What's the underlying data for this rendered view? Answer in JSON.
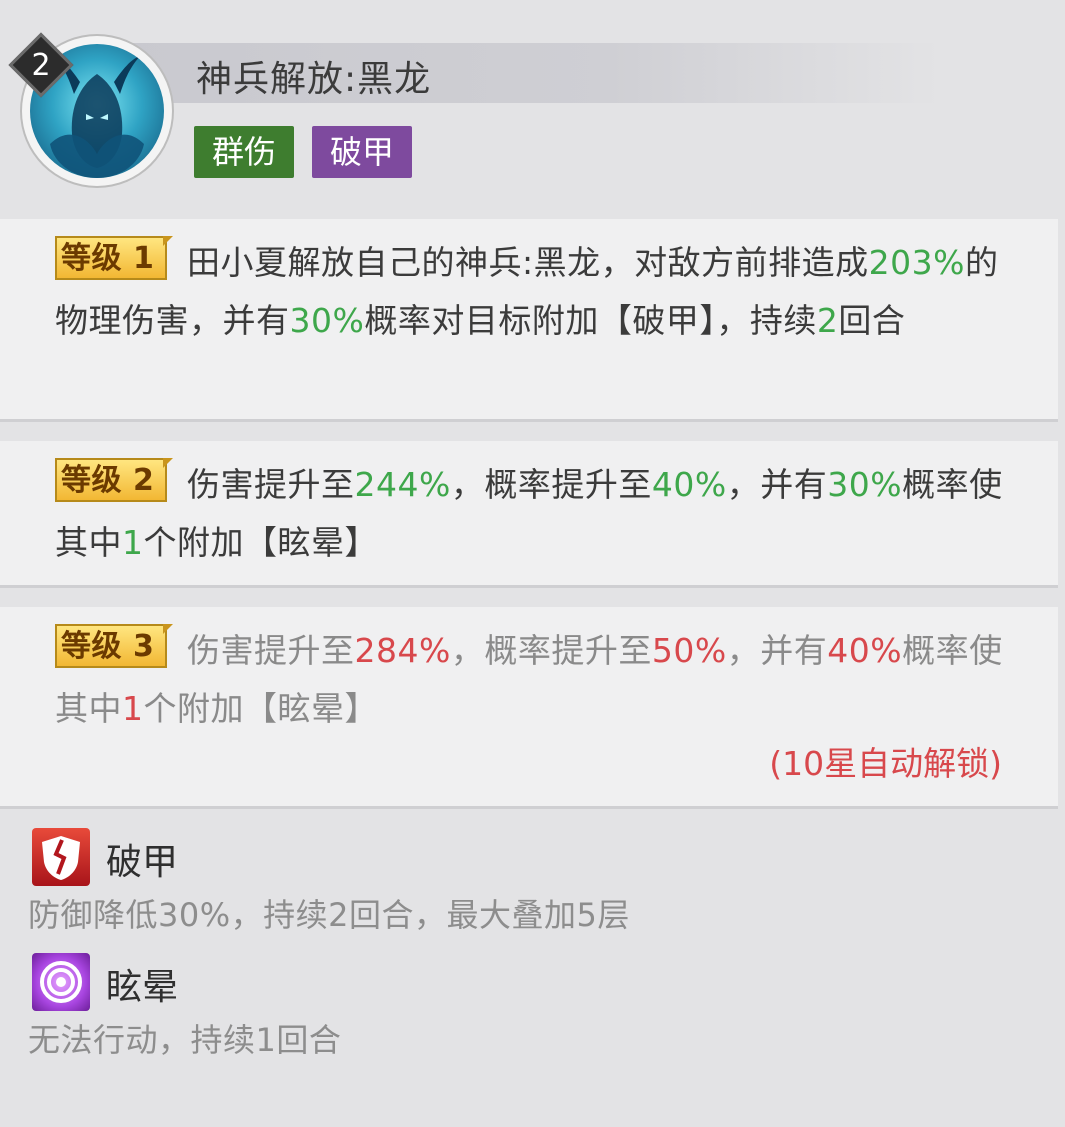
{
  "header": {
    "level": "2",
    "title": "神兵解放:黑龙",
    "tags": [
      "群伤",
      "破甲"
    ],
    "tag_colors": {
      "群伤": "#3e7d2f",
      "破甲": "#7e4a9e"
    },
    "avatar_icon": "dark-dragon-warrior-portrait"
  },
  "levels": [
    {
      "badge": "等级 1",
      "parts": [
        {
          "t": "田小夏解放自己的神兵:黑龙，对敌方前排造成"
        },
        {
          "t": "203%",
          "c": "g"
        },
        {
          "t": "的物理伤害，并有"
        },
        {
          "t": "30%",
          "c": "g"
        },
        {
          "t": "概率对目标附加【破甲】，持续"
        },
        {
          "t": "2",
          "c": "g"
        },
        {
          "t": "回合"
        }
      ]
    },
    {
      "badge": "等级 2",
      "parts": [
        {
          "t": "伤害提升至"
        },
        {
          "t": "244%",
          "c": "g"
        },
        {
          "t": "，概率提升至"
        },
        {
          "t": "40%",
          "c": "g"
        },
        {
          "t": "，并有"
        },
        {
          "t": "30%",
          "c": "g"
        },
        {
          "t": "概率使其中"
        },
        {
          "t": "1",
          "c": "g"
        },
        {
          "t": "个附加【眩晕】"
        }
      ]
    },
    {
      "badge": "等级 3",
      "locked": true,
      "parts": [
        {
          "t": "伤害提升至"
        },
        {
          "t": "284%",
          "c": "r"
        },
        {
          "t": "，概率提升至"
        },
        {
          "t": "50%",
          "c": "r"
        },
        {
          "t": "，并有"
        },
        {
          "t": "40%",
          "c": "r"
        },
        {
          "t": "概率使其中"
        },
        {
          "t": "1",
          "c": "r"
        },
        {
          "t": "个附加【眩晕】"
        }
      ],
      "unlock_note": "(10星自动解锁)"
    }
  ],
  "effects": [
    {
      "name": "破甲",
      "desc": "防御降低30%，持续2回合，最大叠加5层",
      "icon": "broken-shield-icon"
    },
    {
      "name": "眩晕",
      "desc": "无法行动，持续1回合",
      "icon": "concentric-circle-icon"
    }
  ],
  "colors": {
    "green_value": "#3ea74b",
    "red_value": "#d8484c",
    "badge_gold": "#f2b733"
  }
}
